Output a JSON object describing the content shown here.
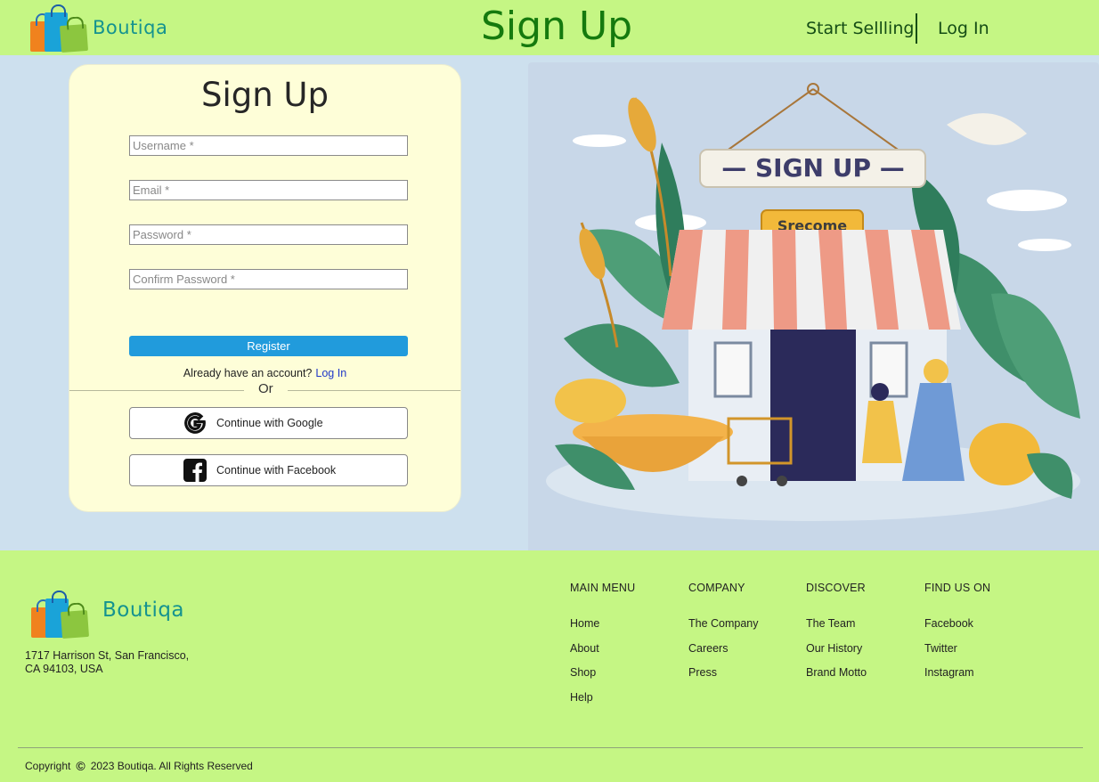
{
  "header": {
    "brand": "Boutiqa",
    "title": "Sign Up",
    "start_selling": "Start Sellling",
    "login": "Log In"
  },
  "form": {
    "title": "Sign Up",
    "username_placeholder": "Username *",
    "email_placeholder": "Email *",
    "password_placeholder": "Password *",
    "confirm_placeholder": "Confirm Password *",
    "register_label": "Register",
    "already_text": "Already have an account?",
    "login_link": "Log In",
    "or_text": "Or",
    "google_label": "Continue with Google",
    "facebook_label": "Continue with Facebook"
  },
  "illustration": {
    "sign_text": "— SIGN UP —",
    "badge_text": "Srecome"
  },
  "footer": {
    "brand": "Boutiqa",
    "address_line1": "1717 Harrison St, San Francisco,",
    "address_line2": "CA 94103, USA",
    "columns": [
      {
        "heading": "MAIN MENU",
        "links": [
          "Home",
          "About",
          "Shop",
          "Help"
        ]
      },
      {
        "heading": "COMPANY",
        "links": [
          "The Company",
          "Careers",
          "Press"
        ]
      },
      {
        "heading": "DISCOVER",
        "links": [
          "The Team",
          "Our History",
          "Brand Motto"
        ]
      },
      {
        "heading": "FIND US ON",
        "links": [
          "Facebook",
          "Twitter",
          "Instagram"
        ]
      }
    ],
    "copyright_prefix": "Copyright",
    "copyright_symbol": "©",
    "copyright_text": "2023  Boutiqa. All Rights Reserved"
  },
  "colors": {
    "background": "#c5f684",
    "title_green": "#157a0e",
    "brand_teal": "#15938f",
    "register_blue": "#219bdc",
    "form_card": "#fefed8",
    "main_bg": "#cde0ee"
  }
}
